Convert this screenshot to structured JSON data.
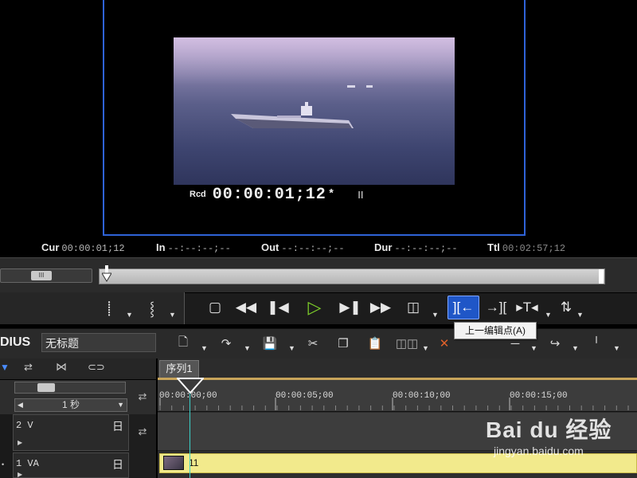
{
  "preview": {
    "rcd_label": "Rcd",
    "rcd_timecode": "00:00:01;12",
    "rcd_marker": "*",
    "pause_glyph": "II"
  },
  "timecodes": [
    {
      "key": "Cur",
      "value": "00:00:01;12"
    },
    {
      "key": "In",
      "value": "--:--:--;--"
    },
    {
      "key": "Out",
      "value": "--:--:--;--"
    },
    {
      "key": "Dur",
      "value": "--:--:--;--"
    },
    {
      "key": "Ttl",
      "value": "00:02:57;12"
    }
  ],
  "transport": {
    "tooltip": "上一编辑点(A)"
  },
  "project": {
    "brand": "DIUS",
    "name": "无标题"
  },
  "timeline": {
    "sequence_tab": "序列1",
    "scale": "1 秒",
    "ruler_ticks": [
      "00:00:00;00",
      "00:00:05;00",
      "00:00:10;00",
      "00:00:15;00"
    ],
    "tracks": [
      {
        "name": "2 V",
        "icon": "日"
      },
      {
        "name": "1 VA",
        "icon": "日"
      }
    ],
    "clip_name": "11"
  },
  "watermark": {
    "brand": "Bai du 经验",
    "url": "jingyan.baidu.com"
  },
  "colors": {
    "highlight": "#1f56c7",
    "monitor_border": "#2f63d8",
    "clip": "#f2ea8c",
    "play": "#7fd12a"
  }
}
